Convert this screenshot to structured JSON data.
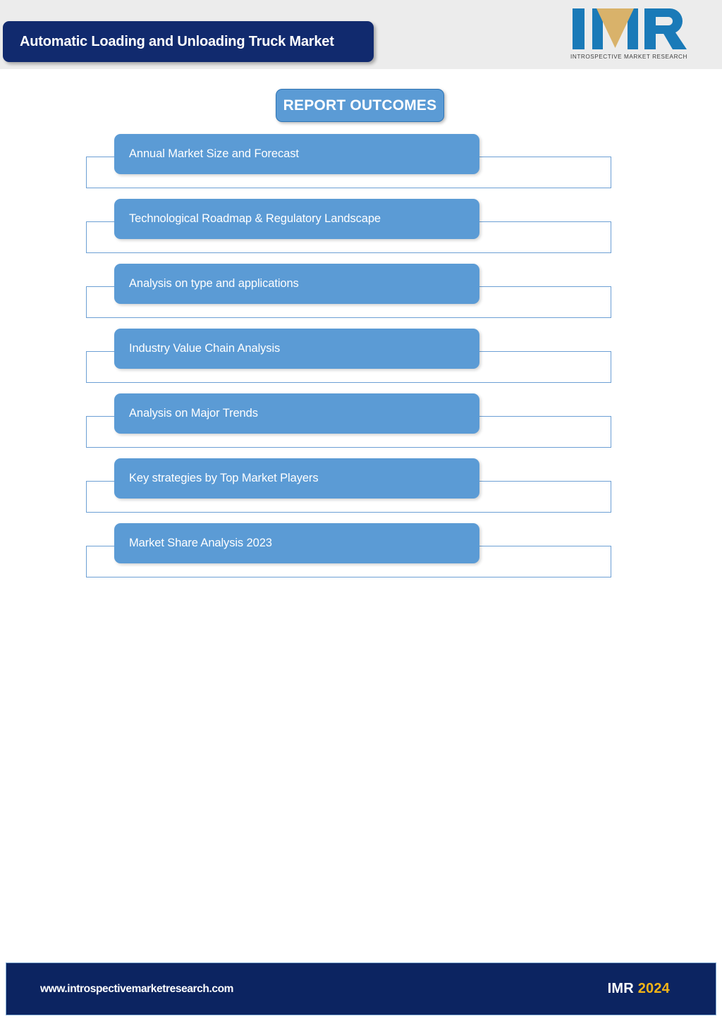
{
  "header": {
    "title": "Automatic Loading and Unloading Truck Market",
    "background_color": "#ececec",
    "title_box_color": "#112a6e"
  },
  "logo": {
    "mark_letters": "IMR",
    "tagline": "INTROSPECTIVE MARKET RESEARCH",
    "blue": "#1a7ab8",
    "gold": "#d9b26a"
  },
  "outcomes": {
    "heading": "REPORT OUTCOMES",
    "accent_color": "#5b9bd5",
    "frame_border_color": "#6c9fd4",
    "items": [
      {
        "label": "Annual Market Size and Forecast"
      },
      {
        "label": "Technological Roadmap & Regulatory Landscape"
      },
      {
        "label": "Analysis on type and applications"
      },
      {
        "label": "Industry Value Chain Analysis"
      },
      {
        "label": "Analysis on Major Trends"
      },
      {
        "label": "Key strategies by Top Market Players"
      },
      {
        "label": "Market Share Analysis 2023"
      }
    ]
  },
  "footer": {
    "url": "www.introspectivemarketresearch.com",
    "brand": "IMR",
    "year": "2024",
    "background_color": "#0c2461",
    "year_color": "#f2b417"
  }
}
